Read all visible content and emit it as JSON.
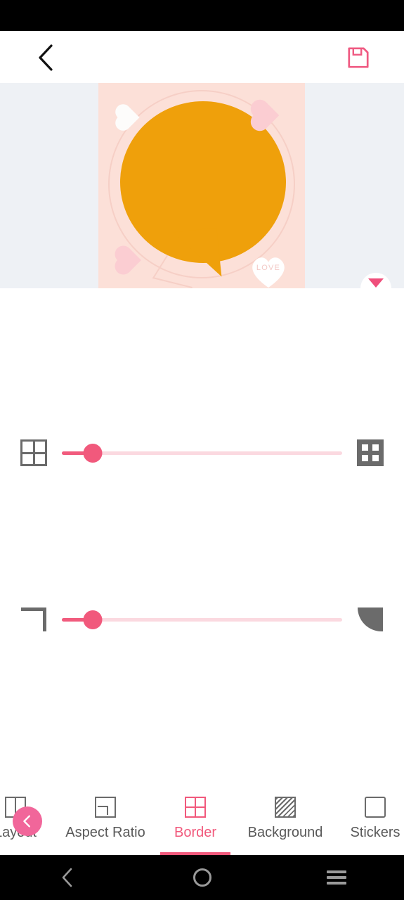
{
  "app": {
    "topbar": {
      "back_icon": "chevron-left-icon",
      "save_icon": "save-floppy-icon"
    }
  },
  "canvas": {
    "background_color": "#eef1f5",
    "artboard_color": "#fce0d8",
    "bubble_color": "#efa00b",
    "sticker_label": "LOVE",
    "toggle_icon": "caret-down-icon",
    "stickers": [
      {
        "name": "heart-white-top-left",
        "color": "#fdfcfb"
      },
      {
        "name": "heart-pink-top-right",
        "color": "#fbcdd2"
      },
      {
        "name": "heart-pink-bottom-left",
        "color": "#fbcdd2"
      },
      {
        "name": "heart-love-bottom-right",
        "color": "#ffffff"
      }
    ]
  },
  "controls": {
    "accent_color": "#f1597c",
    "track_color": "#fbd9e0",
    "sliders": [
      {
        "name": "border-width",
        "left_icon": "grid-thin-icon",
        "right_icon": "grid-thick-icon",
        "value_percent": 11
      },
      {
        "name": "corner-radius",
        "left_icon": "corner-sharp-icon",
        "right_icon": "corner-rounded-icon",
        "value_percent": 11
      }
    ]
  },
  "toolbar": {
    "back_icon": "chevron-left-circle-icon",
    "active_tab": "Border",
    "items": [
      {
        "label": "Layout",
        "icon": "layout-icon",
        "active": false
      },
      {
        "label": "Aspect Ratio",
        "icon": "aspect-ratio-icon",
        "active": false
      },
      {
        "label": "Border",
        "icon": "border-grid-icon",
        "active": true
      },
      {
        "label": "Background",
        "icon": "background-hatch-icon",
        "active": false
      },
      {
        "label": "Stickers",
        "icon": "sticker-icon",
        "active": false
      }
    ]
  },
  "navbar": {
    "back_icon": "nav-back-icon",
    "home_icon": "nav-home-icon",
    "recents_icon": "nav-menu-icon"
  }
}
